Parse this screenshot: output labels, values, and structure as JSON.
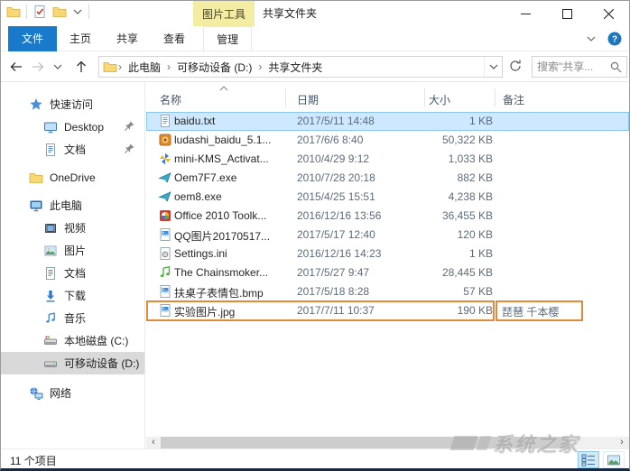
{
  "window": {
    "title": "共享文件夹",
    "contextual_tool_label": "图片工具"
  },
  "colors": {
    "file_tab_blue": "#1979ca",
    "contextual_yellow": "#f2eda2",
    "annotation_orange": "#e28a3a",
    "selected_row_blue": "#cde8ff",
    "sidebar_selected_gray": "#d9d9d9"
  },
  "titlebar_icons": [
    {
      "name": "app-folder",
      "icon": "folder"
    },
    {
      "name": "qat-properties",
      "icon": "checkdoc"
    },
    {
      "name": "qat-new-folder",
      "icon": "folder"
    },
    {
      "name": "qat-customize-caret",
      "icon": "caretdown"
    }
  ],
  "ribbon": {
    "tabs": [
      {
        "label": "文件",
        "style": "file"
      },
      {
        "label": "主页",
        "style": "normal"
      },
      {
        "label": "共享",
        "style": "normal"
      },
      {
        "label": "查看",
        "style": "normal"
      },
      {
        "label": "管理",
        "style": "contextual"
      }
    ]
  },
  "nav": {
    "breadcrumb": [
      "此电脑",
      "可移动设备 (D:)",
      "共享文件夹"
    ],
    "search_placeholder": "搜索\"共享..."
  },
  "sidebar": {
    "items": [
      {
        "label": "快速访问",
        "icon": "star",
        "level": 0,
        "gap": 0
      },
      {
        "label": "Desktop",
        "icon": "monitor",
        "level": 1,
        "pinned": true
      },
      {
        "label": "文档",
        "icon": "doc",
        "level": 1,
        "pinned": true
      },
      {
        "label": "OneDrive",
        "icon": "folder",
        "level": 0,
        "gap": 6
      },
      {
        "label": "此电脑",
        "icon": "pc",
        "level": 0,
        "gap": 6
      },
      {
        "label": "视频",
        "icon": "film",
        "level": 1
      },
      {
        "label": "图片",
        "icon": "pic",
        "level": 1
      },
      {
        "label": "文档",
        "icon": "doc",
        "level": 1
      },
      {
        "label": "下载",
        "icon": "download",
        "level": 1
      },
      {
        "label": "音乐",
        "icon": "note",
        "level": 1
      },
      {
        "label": "本地磁盘 (C:)",
        "icon": "diskwin",
        "level": 1
      },
      {
        "label": "可移动设备 (D:)",
        "icon": "disk",
        "level": 1,
        "selected": true
      },
      {
        "label": "网络",
        "icon": "network",
        "level": 0,
        "gap": 8
      }
    ]
  },
  "file_list": {
    "columns": [
      "名称",
      "日期",
      "大小",
      "备注"
    ],
    "rows": [
      {
        "name": "baidu.txt",
        "date": "2017/5/11 14:48",
        "size": "1 KB",
        "comment": "",
        "icon": "txt",
        "selected": true
      },
      {
        "name": "ludashi_baidu_5.1...",
        "date": "2017/6/6 8:40",
        "size": "50,322 KB",
        "comment": "",
        "icon": "ludashi"
      },
      {
        "name": "mini-KMS_Activat...",
        "date": "2010/4/29 9:12",
        "size": "1,033 KB",
        "comment": "",
        "icon": "kms"
      },
      {
        "name": "Oem7F7.exe",
        "date": "2010/7/28 20:18",
        "size": "882 KB",
        "comment": "",
        "icon": "plane"
      },
      {
        "name": "oem8.exe",
        "date": "2015/4/25 15:51",
        "size": "4,238 KB",
        "comment": "",
        "icon": "plane"
      },
      {
        "name": "Office 2010 Toolk...",
        "date": "2016/12/16 13:56",
        "size": "36,455 KB",
        "comment": "",
        "icon": "office"
      },
      {
        "name": "QQ图片20170517...",
        "date": "2017/5/17 12:40",
        "size": "120 KB",
        "comment": "",
        "icon": "image"
      },
      {
        "name": "Settings.ini",
        "date": "2016/12/16 14:23",
        "size": "1 KB",
        "comment": "",
        "icon": "ini"
      },
      {
        "name": "The Chainsmoker...",
        "date": "2017/5/27 9:47",
        "size": "28,445 KB",
        "comment": "",
        "icon": "music"
      },
      {
        "name": "扶桌子表情包.bmp",
        "date": "2017/5/18 8:28",
        "size": "57 KB",
        "comment": "",
        "icon": "image"
      },
      {
        "name": "实验图片.jpg",
        "date": "2017/7/11 10:37",
        "size": "190 KB",
        "comment": "琵琶 千本樱",
        "icon": "image",
        "annotated": true
      }
    ]
  },
  "status_bar": {
    "items_count": "11 个项目"
  },
  "watermark": {
    "text": "系统之家"
  }
}
